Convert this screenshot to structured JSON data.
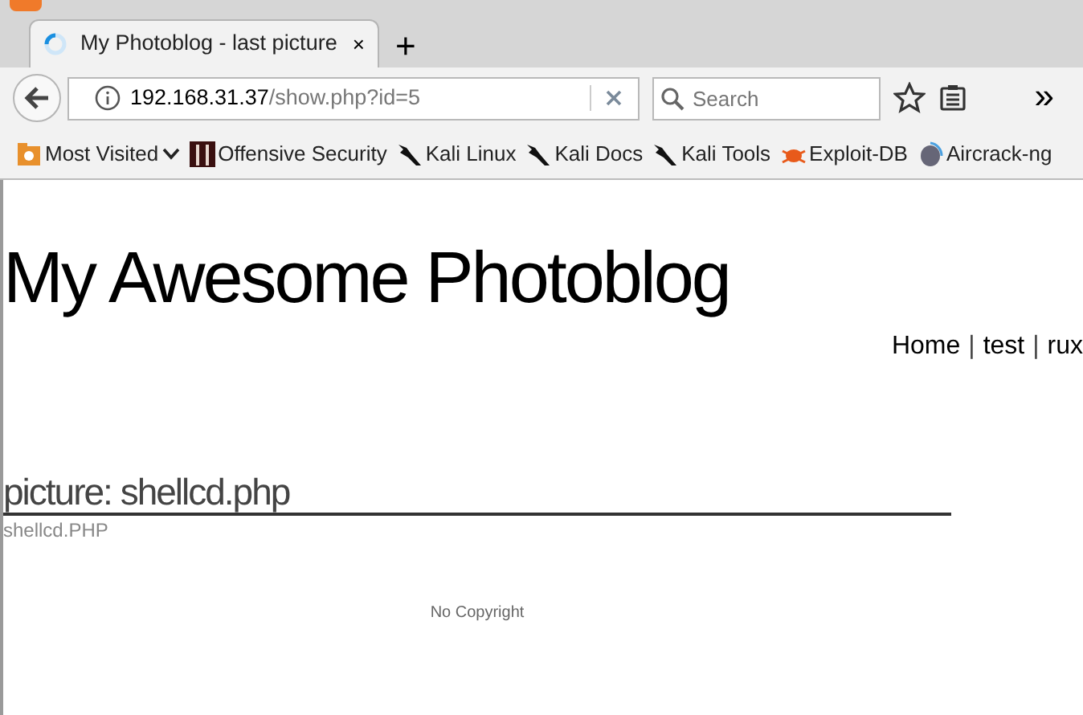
{
  "browser": {
    "tab": {
      "title": "My Photoblog - last picture",
      "close": "×",
      "selected": true
    },
    "new_tab": "+",
    "url": {
      "host": "192.168.31.37",
      "path": "/show.php?id=5"
    },
    "search": {
      "placeholder": "Search"
    },
    "overflow": "»",
    "bookmarks": [
      {
        "label": "Most Visited",
        "kind": "folder"
      },
      {
        "label": "Offensive Security",
        "kind": "offsec"
      },
      {
        "label": "Kali Linux",
        "kind": "kali"
      },
      {
        "label": "Kali Docs",
        "kind": "kali"
      },
      {
        "label": "Kali Tools",
        "kind": "kali"
      },
      {
        "label": "Exploit-DB",
        "kind": "exploit"
      },
      {
        "label": "Aircrack-ng",
        "kind": "aircrack"
      }
    ]
  },
  "page": {
    "title": "My Awesome Photoblog",
    "nav": [
      {
        "kind": "link",
        "label": "Home"
      },
      {
        "kind": "sep",
        "label": "|"
      },
      {
        "kind": "link",
        "label": "test"
      },
      {
        "kind": "sep",
        "label": "|"
      },
      {
        "kind": "link",
        "label": "rux"
      }
    ],
    "picture": {
      "heading": "picture: shellcd.php",
      "caption": "shellcd.PHP"
    },
    "footer": "No Copyright"
  }
}
